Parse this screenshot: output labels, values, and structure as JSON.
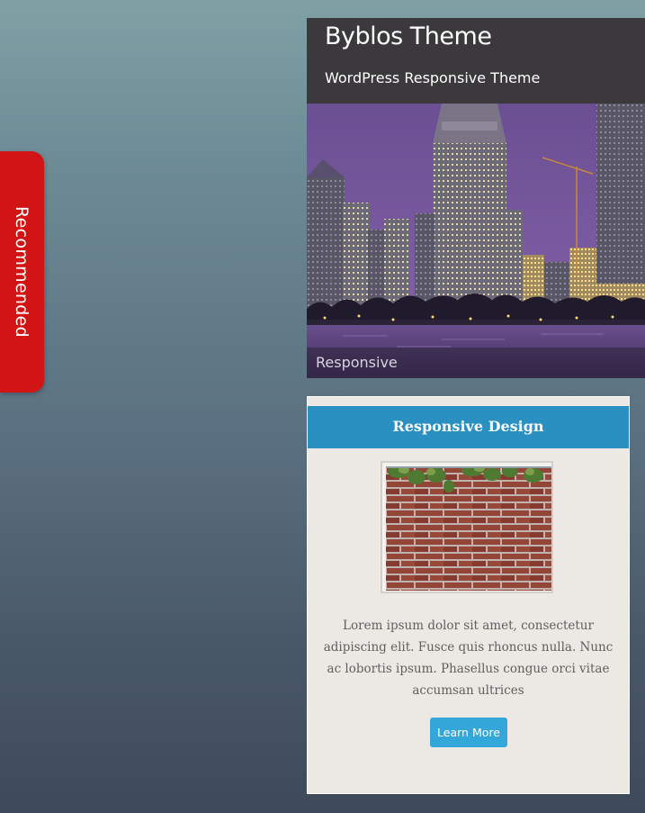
{
  "side_tab": {
    "label": "Recommended"
  },
  "header": {
    "title": "Byblos Theme",
    "tagline": "WordPress Responsive Theme"
  },
  "hero": {
    "caption": "Responsive"
  },
  "feature_card": {
    "title": "Responsive Design",
    "body": "Lorem ipsum dolor sit amet, consectetur adipiscing elit. Fusce quis rhoncus nulla. Nunc ac lobortis ipsum. Phasellus congue orci vitae accumsan ultrices",
    "button_label": "Learn More"
  },
  "colors": {
    "side_tab": "#d21414",
    "header_bg": "#3b393c",
    "card_header": "#2a8fc1",
    "button": "#33a7da",
    "card_bg": "#ece9e5"
  }
}
